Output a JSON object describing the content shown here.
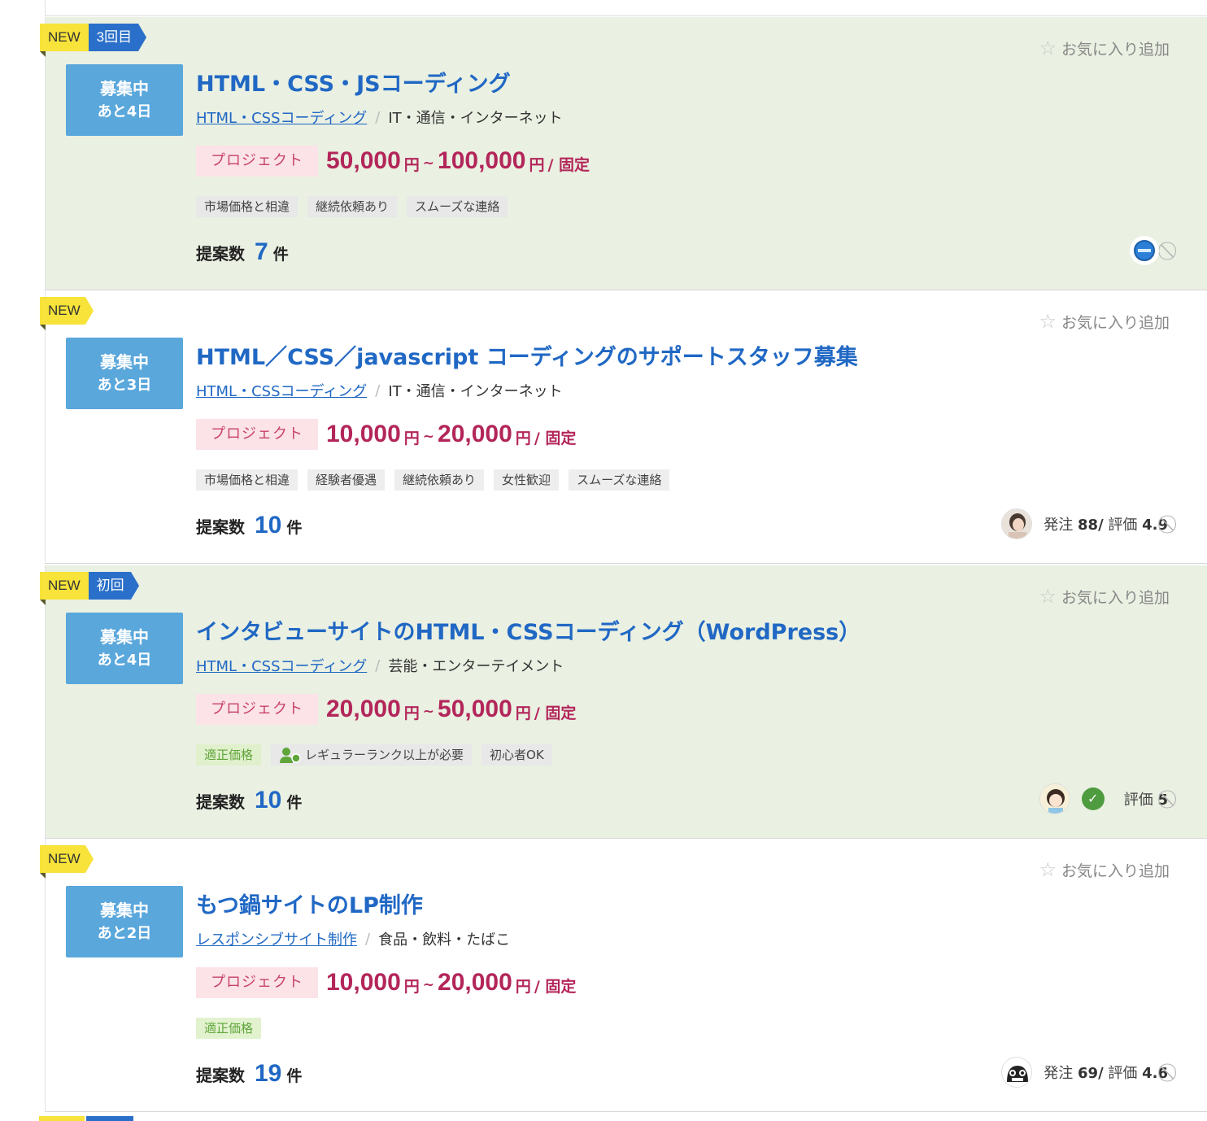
{
  "favorite_label": "お気に入り追加",
  "listings": [
    {
      "badges": {
        "new": "NEW",
        "count": "3回目"
      },
      "status": {
        "state": "募集中",
        "remaining": "あと4日"
      },
      "title": "HTML・CSS・JSコーディング",
      "category": "HTML・CSSコーディング",
      "industry": "IT・通信・インターネット",
      "price": {
        "type": "プロジェクト",
        "min": "50,000",
        "max": "100,000",
        "unit": "円",
        "tilde": "~",
        "fixed": "/ 固定"
      },
      "tags": [
        {
          "label": "市場価格と相違",
          "style": "gray"
        },
        {
          "label": "継続依頼あり",
          "style": "gray"
        },
        {
          "label": "スムーズな連絡",
          "style": "gray"
        }
      ],
      "proposals": {
        "label": "提案数",
        "count": "7",
        "unit": "件"
      },
      "client": {
        "avatar": "blue-logo",
        "verified": false,
        "stats": ""
      },
      "highlight": true
    },
    {
      "badges": {
        "new": "NEW",
        "count": ""
      },
      "status": {
        "state": "募集中",
        "remaining": "あと3日"
      },
      "title": "HTML／CSS／javascript コーディングのサポートスタッフ募集",
      "category": "HTML・CSSコーディング",
      "industry": "IT・通信・インターネット",
      "price": {
        "type": "プロジェクト",
        "min": "10,000",
        "max": "20,000",
        "unit": "円",
        "tilde": "~",
        "fixed": "/ 固定"
      },
      "tags": [
        {
          "label": "市場価格と相違",
          "style": "gray"
        },
        {
          "label": "経験者優遇",
          "style": "gray"
        },
        {
          "label": "継続依頼あり",
          "style": "gray"
        },
        {
          "label": "女性歓迎",
          "style": "gray"
        },
        {
          "label": "スムーズな連絡",
          "style": "gray"
        }
      ],
      "proposals": {
        "label": "提案数",
        "count": "10",
        "unit": "件"
      },
      "client": {
        "avatar": "photo-woman",
        "verified": false,
        "orders_label": "発注",
        "orders": "88/",
        "rating_label": "評価",
        "rating": "4.9"
      },
      "highlight": false
    },
    {
      "badges": {
        "new": "NEW",
        "count": "初回"
      },
      "status": {
        "state": "募集中",
        "remaining": "あと4日"
      },
      "title": "インタビューサイトのHTML・CSSコーディング（WordPress）",
      "category": "HTML・CSSコーディング",
      "industry": "芸能・エンターテイメント",
      "price": {
        "type": "プロジェクト",
        "min": "20,000",
        "max": "50,000",
        "unit": "円",
        "tilde": "~",
        "fixed": "/ 固定"
      },
      "tags": [
        {
          "label": "適正価格",
          "style": "green"
        },
        {
          "label": "レギュラーランク以上が必要",
          "style": "rank"
        },
        {
          "label": "初心者OK",
          "style": "gray"
        }
      ],
      "proposals": {
        "label": "提案数",
        "count": "10",
        "unit": "件"
      },
      "client": {
        "avatar": "illustration-girl",
        "verified": true,
        "rating_label": "評価",
        "rating": "5"
      },
      "highlight": true
    },
    {
      "badges": {
        "new": "NEW",
        "count": ""
      },
      "status": {
        "state": "募集中",
        "remaining": "あと2日"
      },
      "title": "もつ鍋サイトのLP制作",
      "category": "レスポンシブサイト制作",
      "industry": "食品・飲料・たばこ",
      "price": {
        "type": "プロジェクト",
        "min": "10,000",
        "max": "20,000",
        "unit": "円",
        "tilde": "~",
        "fixed": "/ 固定"
      },
      "tags": [
        {
          "label": "適正価格",
          "style": "green"
        }
      ],
      "proposals": {
        "label": "提案数",
        "count": "19",
        "unit": "件"
      },
      "client": {
        "avatar": "mono-character",
        "verified": false,
        "orders_label": "発注",
        "orders": "69/",
        "rating_label": "評価",
        "rating": "4.6"
      },
      "highlight": false
    }
  ],
  "icons": {
    "favorite": "star-outline-icon",
    "block": "block-icon",
    "verified": "check-badge-icon"
  },
  "colors": {
    "title": "#2068c4",
    "price": "#b3265a",
    "status_bg": "#5aa7dc",
    "highlight_bg": "#eaf0e2",
    "new_badge": "#f7e33a",
    "count_badge": "#2a6fc9"
  }
}
